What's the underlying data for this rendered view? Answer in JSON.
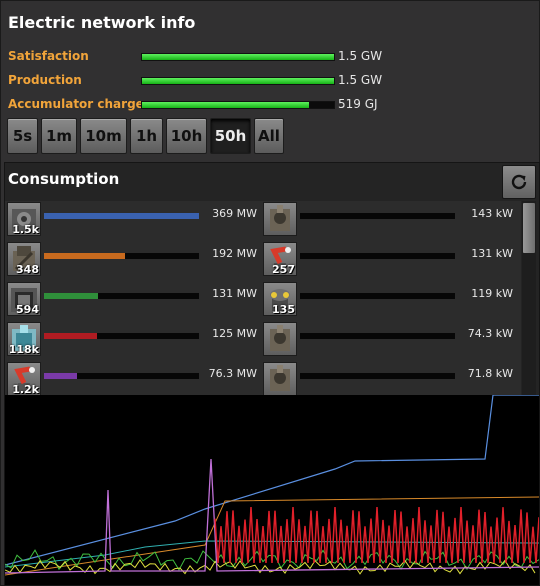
{
  "title": "Electric network info",
  "stats": [
    {
      "label": "Satisfaction",
      "value": "1.5 GW",
      "fill": 1.0
    },
    {
      "label": "Production",
      "value": "1.5 GW",
      "fill": 1.0
    },
    {
      "label": "Accumulator charge",
      "value": "519 GJ",
      "fill": 0.87
    }
  ],
  "time_buttons": [
    "5s",
    "1m",
    "10m",
    "1h",
    "10h",
    "50h",
    "All"
  ],
  "active_time_button": "50h",
  "consumption_title": "Consumption",
  "left_entries": [
    {
      "count": "1.5k",
      "value": "369 MW",
      "fill": 1.0,
      "color": "#3a62b0",
      "icon": "assembling-machine-icon"
    },
    {
      "count": "348",
      "value": "192 MW",
      "fill": 0.52,
      "color": "#c86a1e",
      "icon": "mining-drill-icon"
    },
    {
      "count": "594",
      "value": "131 MW",
      "fill": 0.35,
      "color": "#2f8f3a",
      "icon": "electric-furnace-icon"
    },
    {
      "count": "118k",
      "value": "125 MW",
      "fill": 0.34,
      "color": "#b01c22",
      "icon": "roboport-icon"
    },
    {
      "count": "1.2k",
      "value": "76.3 MW",
      "fill": 0.21,
      "color": "#7a3aa8",
      "icon": "inserter-icon"
    }
  ],
  "right_entries": [
    {
      "count": "",
      "value": "143 kW",
      "fill": 0.0,
      "icon": "pump-icon"
    },
    {
      "count": "257",
      "value": "131 kW",
      "fill": 0.0,
      "icon": "inserter-icon"
    },
    {
      "count": "135",
      "value": "119 kW",
      "fill": 0.0,
      "icon": "radar-icon"
    },
    {
      "count": "",
      "value": "74.3 kW",
      "fill": 0.0,
      "icon": "pump-icon"
    },
    {
      "count": "",
      "value": "71.8 kW",
      "fill": 0.0,
      "icon": "pump-icon"
    }
  ],
  "graph_colors": {
    "blue": "#5a8fe0",
    "orange": "#d98a2a",
    "red": "#e0202a",
    "violet": "#c070d8",
    "yellow": "#e0e040",
    "green": "#40c040",
    "teal": "#30b0b0"
  }
}
